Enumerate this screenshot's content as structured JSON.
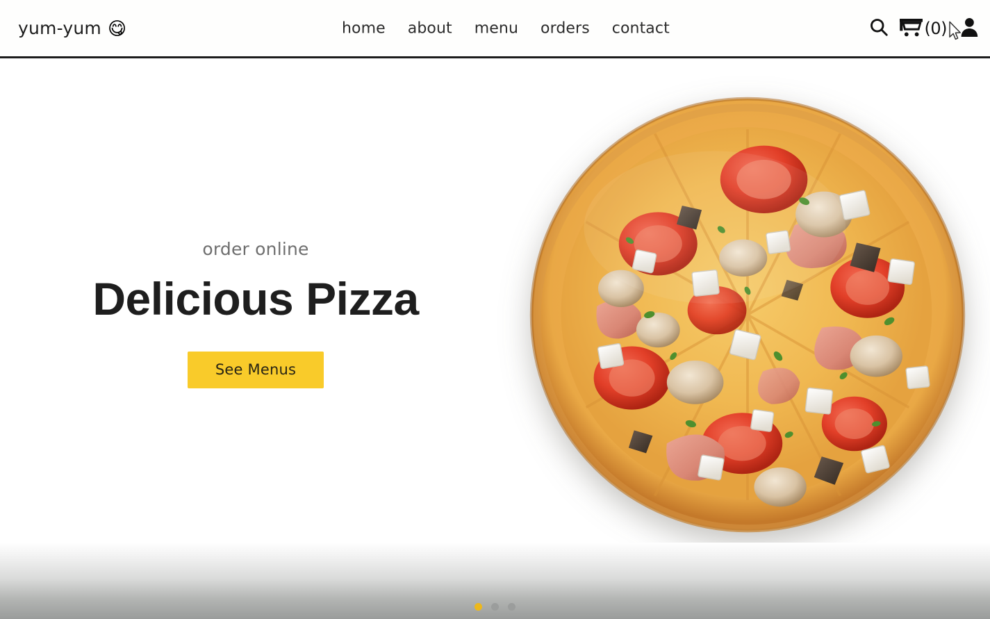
{
  "header": {
    "brand": {
      "name": "yum-yum",
      "emoji": "😋",
      "emoji_icon": "face-savoring-food-emoji"
    },
    "nav": [
      {
        "label": "home",
        "name": "nav-link-home"
      },
      {
        "label": "about",
        "name": "nav-link-about"
      },
      {
        "label": "menu",
        "name": "nav-link-menu"
      },
      {
        "label": "orders",
        "name": "nav-link-orders"
      },
      {
        "label": "contact",
        "name": "nav-link-contact"
      }
    ],
    "actions": {
      "search_icon": "search-icon",
      "cart_icon": "shopping-cart-icon",
      "cart_count": "(0)",
      "account_icon": "user-account-icon"
    }
  },
  "hero": {
    "eyebrow": "order online",
    "title": "Delicious Pizza",
    "cta_label": "See Menus",
    "image_alt": "pizza-photo"
  },
  "carousel": {
    "slides": 3,
    "active_index": 0
  },
  "colors": {
    "accent_yellow": "#f9cb2a",
    "dot_active": "#edb81c",
    "dot_inactive": "#9b9d9c",
    "header_border": "#1c1c1c",
    "title_text": "#1e1e1e",
    "eyebrow_text": "#6e6e6e",
    "band_bottom": "#9a9c9b"
  }
}
